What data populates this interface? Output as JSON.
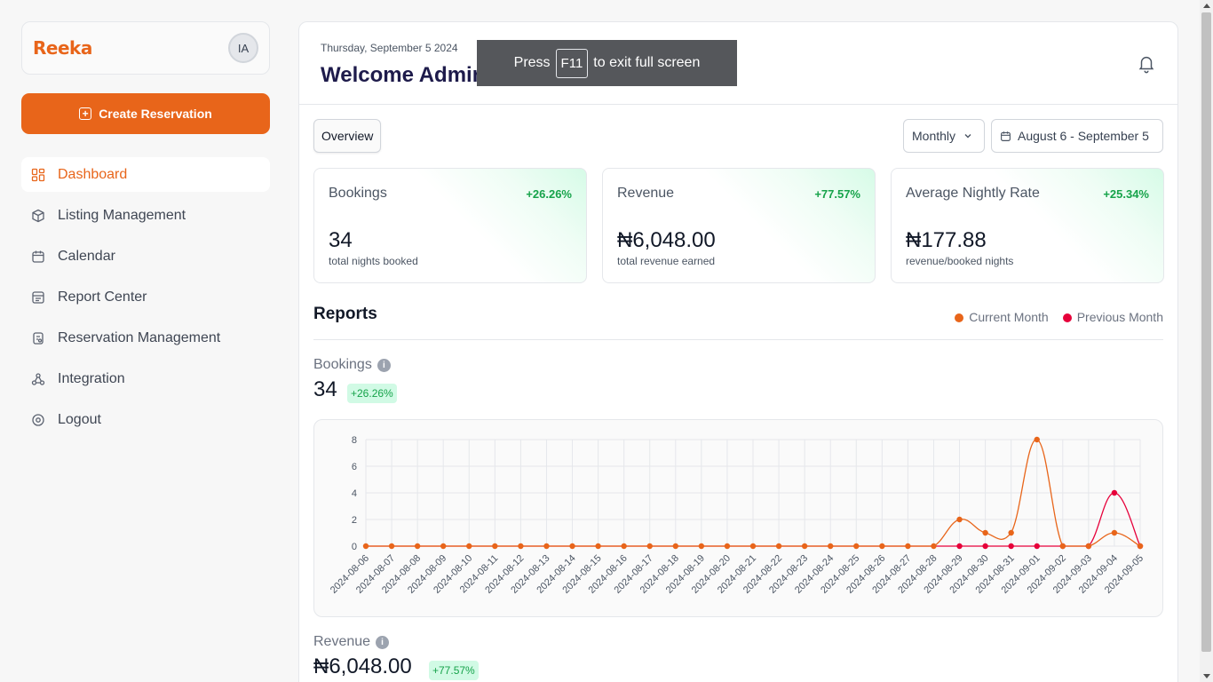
{
  "brand": {
    "name": "Reeka",
    "avatar_initials": "IA"
  },
  "sidebar": {
    "create_button": "Create Reservation",
    "items": [
      {
        "label": "Dashboard",
        "icon": "dashboard-icon",
        "active": true
      },
      {
        "label": "Listing Management",
        "icon": "box-icon"
      },
      {
        "label": "Calendar",
        "icon": "calendar-icon"
      },
      {
        "label": "Report Center",
        "icon": "report-icon"
      },
      {
        "label": "Reservation Management",
        "icon": "reservation-icon"
      },
      {
        "label": "Integration",
        "icon": "integration-icon"
      },
      {
        "label": "Logout",
        "icon": "logout-icon"
      }
    ]
  },
  "header": {
    "date": "Thursday, September 5 2024",
    "welcome": "Welcome Admin"
  },
  "fullscreen_toast": {
    "before": "Press",
    "key": "F11",
    "after": "to exit full screen"
  },
  "toolbar": {
    "tab": "Overview",
    "period": "Monthly",
    "date_range": "August 6 - September 5"
  },
  "cards": [
    {
      "title": "Bookings",
      "change": "+26.26%",
      "value": "34",
      "sub": "total nights booked"
    },
    {
      "title": "Revenue",
      "change": "+77.57%",
      "value": "₦6,048.00",
      "sub": "total revenue earned"
    },
    {
      "title": "Average Nightly Rate",
      "change": "+25.34%",
      "value": "₦177.88",
      "sub": "revenue/booked nights"
    }
  ],
  "reports": {
    "title": "Reports",
    "legend": [
      "Current Month",
      "Previous Month"
    ],
    "bookings": {
      "label": "Bookings",
      "value": "34",
      "change": "+26.26%"
    },
    "revenue": {
      "label": "Revenue",
      "value": "₦6,048.00",
      "change": "+77.57%"
    }
  },
  "colors": {
    "accent": "#e8651a",
    "current": "#e8651a",
    "previous": "#e6003a",
    "positive": "#16a34a"
  },
  "chart_data": {
    "type": "line",
    "x": [
      "2024-08-06",
      "2024-08-07",
      "2024-08-08",
      "2024-08-09",
      "2024-08-10",
      "2024-08-11",
      "2024-08-12",
      "2024-08-13",
      "2024-08-14",
      "2024-08-15",
      "2024-08-16",
      "2024-08-17",
      "2024-08-18",
      "2024-08-19",
      "2024-08-20",
      "2024-08-21",
      "2024-08-22",
      "2024-08-23",
      "2024-08-24",
      "2024-08-25",
      "2024-08-26",
      "2024-08-27",
      "2024-08-28",
      "2024-08-29",
      "2024-08-30",
      "2024-08-31",
      "2024-09-01",
      "2024-09-02",
      "2024-09-03",
      "2024-09-04",
      "2024-09-05"
    ],
    "series": [
      {
        "name": "Current Month",
        "values": [
          0,
          0,
          0,
          0,
          0,
          0,
          0,
          0,
          0,
          0,
          0,
          0,
          0,
          0,
          0,
          0,
          0,
          0,
          0,
          0,
          0,
          0,
          0,
          2,
          1,
          1,
          8,
          0,
          0,
          1,
          0
        ]
      },
      {
        "name": "Previous Month",
        "values": [
          0,
          0,
          0,
          0,
          0,
          0,
          0,
          0,
          0,
          0,
          0,
          0,
          0,
          0,
          0,
          0,
          0,
          0,
          0,
          0,
          0,
          0,
          0,
          0,
          0,
          0,
          0,
          0,
          0,
          4,
          0
        ]
      }
    ],
    "yticks": [
      0,
      2,
      4,
      6,
      8
    ],
    "ylim": [
      0,
      8
    ],
    "grid": true
  }
}
